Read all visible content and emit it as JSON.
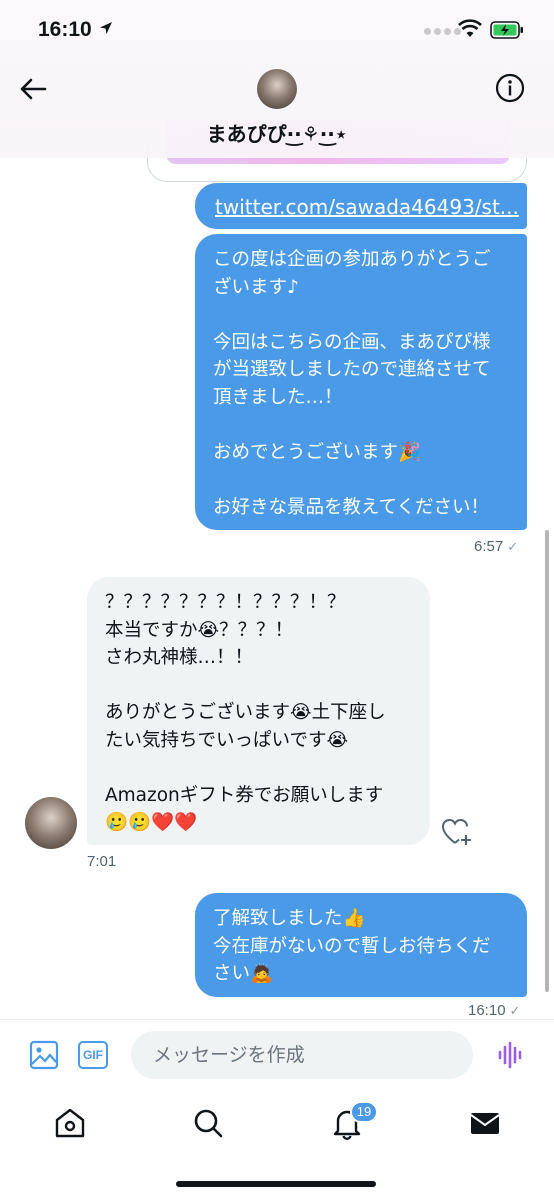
{
  "status_bar": {
    "time": "16:10"
  },
  "header": {
    "name": "まあぴぴ·͜·⚘·͜·⋆"
  },
  "messages": {
    "link_text": "twitter.com/sawada46493/st...",
    "outgoing_1": [
      "この度は企画の参加ありがとうご",
      "ざいます♪",
      "",
      "今回はこちらの企画、まあぴぴ様",
      "が当選致しましたので連絡させて",
      "頂きました…！",
      "",
      "おめでとうございます🎉",
      "",
      "お好きな景品を教えてください！"
    ],
    "outgoing_1_time": "6:57",
    "incoming_1": [
      "？？？？？？？！？？？！？",
      "本当ですか😭？？？！",
      "さわ丸神様…！！",
      "",
      "ありがとうございます😭土下座し",
      "たい気持ちでいっぱいです😭",
      "",
      "Amazonギフト券でお願いします",
      "🥲🥲❤️❤️"
    ],
    "incoming_1_time": "7:01",
    "outgoing_2": [
      "了解致しました👍",
      "今在庫がないので暫しお待ちくだ",
      "さい🙇"
    ],
    "outgoing_2_time": "16:10",
    "read_check": "✓"
  },
  "composer": {
    "placeholder": "メッセージを作成",
    "gif_label": "GIF"
  },
  "bottom_nav": {
    "notifications_badge": "19"
  },
  "colors": {
    "accent": "#4a9ae8",
    "incoming_bubble": "#eff3f4"
  }
}
